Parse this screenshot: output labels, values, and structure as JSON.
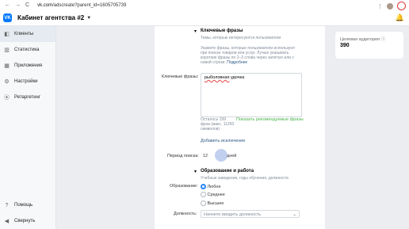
{
  "browser": {
    "back": "←",
    "forward": "→",
    "reload": "C",
    "url_domain": "vk.com",
    "url_path": "/adscreate?parent_id=1605705739"
  },
  "header": {
    "logo": "VK",
    "cabinet_title": "Кабинет агентства #2"
  },
  "sidebar": {
    "items": [
      {
        "label": "Клиенты",
        "icon": "clients-icon",
        "glyph": "◧"
      },
      {
        "label": "Статистика",
        "icon": "stats-icon",
        "glyph": "▥"
      },
      {
        "label": "Приложения",
        "icon": "apps-icon",
        "glyph": "▦"
      },
      {
        "label": "Настройки",
        "icon": "settings-icon",
        "glyph": "⚙"
      },
      {
        "label": "Ретаргетинг",
        "icon": "retarget-icon",
        "glyph": "⦿"
      }
    ],
    "bottom": [
      {
        "label": "Помощь",
        "icon": "help-icon",
        "glyph": "?"
      },
      {
        "label": "Свернуть",
        "icon": "collapse-icon",
        "glyph": "◀"
      }
    ]
  },
  "keywords": {
    "title": "Ключевые фразы",
    "subtitle": "Темы, которые интересуются пользователи",
    "hint": "Укажите фразы, которые пользователи используют при поиске товаров или услуг. Лучше указывать короткие фразы по 2–3 слова через запятую или с новой строки.",
    "more_link": "Подробнее",
    "field_label": "Ключевые фразы:",
    "value_underlined": "рыболовная",
    "value_rest": " удочка",
    "remaining": "Осталось 199 фраз (макс. 11250 символов)",
    "show_recommended": "Показать рекомендуемые фразы",
    "add_exclusion": "Добавить исключение",
    "period_label": "Период поиска:",
    "period_value": "12",
    "period_unit": "дней"
  },
  "education": {
    "title": "Образование и работа",
    "subtitle": "Учебные заведения, годы обучения, должности",
    "label": "Образование:",
    "options": [
      "Любое",
      "Среднее",
      "Высшее"
    ],
    "selected": 0,
    "position_label": "Должность:",
    "position_placeholder": "Начните вводить должность"
  },
  "audience": {
    "label": "Целевая аудитория",
    "value": "390"
  }
}
